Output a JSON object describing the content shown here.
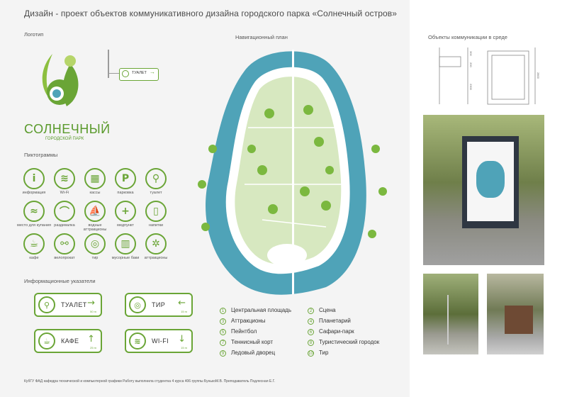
{
  "title": "Дизайн - проект объектов коммуникативного дизайна городского парка «Солнечный остров»",
  "sections": {
    "logo": "Логотип",
    "map": "Навигационный план",
    "pictograms": "Пиктограммы",
    "signs": "Информационные указатели",
    "environment": "Объекты коммуникации в среде"
  },
  "logo": {
    "name": "СОЛНЕЧНЫЙ",
    "sub": "ГОРОДСКОЙ ПАРК"
  },
  "logo_sign": {
    "label": "ТУАЛЕТ"
  },
  "pictograms": [
    {
      "label": "информация",
      "icon": "info-icon",
      "glyph": "i"
    },
    {
      "label": "Wi-Fi",
      "icon": "wifi-icon",
      "glyph": "≋"
    },
    {
      "label": "кассы",
      "icon": "cashier-icon",
      "glyph": "▦"
    },
    {
      "label": "парковка",
      "icon": "parking-icon",
      "glyph": "P"
    },
    {
      "label": "туалет",
      "icon": "toilet-icon",
      "glyph": "⚲"
    },
    {
      "label": "место для купания",
      "icon": "swimming-icon",
      "glyph": "≈"
    },
    {
      "label": "раздевалка",
      "icon": "hanger-icon",
      "glyph": "⌒"
    },
    {
      "label": "водные аттракционы",
      "icon": "boat-icon",
      "glyph": "⛵"
    },
    {
      "label": "медпункт",
      "icon": "medical-icon",
      "glyph": "+"
    },
    {
      "label": "напитки",
      "icon": "drinks-icon",
      "glyph": "▯"
    },
    {
      "label": "кафе",
      "icon": "cafe-icon",
      "glyph": "☕"
    },
    {
      "label": "велопрокат",
      "icon": "bicycle-icon",
      "glyph": "⚯"
    },
    {
      "label": "тир",
      "icon": "target-icon",
      "glyph": "◎"
    },
    {
      "label": "мусорные баки",
      "icon": "trash-icon",
      "glyph": "▥"
    },
    {
      "label": "аттракционы",
      "icon": "ferris-wheel-icon",
      "glyph": "✲"
    }
  ],
  "signs": [
    {
      "label": "ТУАЛЕТ",
      "icon": "toilet-icon",
      "glyph": "⚲",
      "arrow": "→",
      "dist": "50 m"
    },
    {
      "label": "ТИР",
      "icon": "target-icon",
      "glyph": "◎",
      "arrow": "←",
      "dist": "15 m"
    },
    {
      "label": "КАФЕ",
      "icon": "cafe-icon",
      "glyph": "☕",
      "arrow": "↑",
      "dist": "25 m"
    },
    {
      "label": "WI-FI",
      "icon": "wifi-icon",
      "glyph": "≋",
      "arrow": "↓",
      "dist": "15 m"
    }
  ],
  "legend": [
    {
      "num": "1",
      "label": "Центральная площадь"
    },
    {
      "num": "2",
      "label": "Сцена"
    },
    {
      "num": "3",
      "label": "Аттракционы"
    },
    {
      "num": "4",
      "label": "Планетарий"
    },
    {
      "num": "5",
      "label": "Пейнтбол"
    },
    {
      "num": "6",
      "label": "Сафари-парк"
    },
    {
      "num": "7",
      "label": "Теннисный корт"
    },
    {
      "num": "8",
      "label": "Туристический городок"
    },
    {
      "num": "9",
      "label": "Ледовый дворец"
    },
    {
      "num": "10",
      "label": "Тир"
    }
  ],
  "drawing_dims": {
    "d1": "300",
    "d2": "200",
    "d3": "2300",
    "total": "2800"
  },
  "footer": "КубГУ ФАД кафедра технической и компьютерной графики Работу выполнила студентка 4 курса 406 группы БунькоМ.В. Преподаватель Подлесная Е.Г.",
  "colors": {
    "accent": "#6aa536",
    "water": "#4fa3b8",
    "land": "#d7e8c0"
  }
}
